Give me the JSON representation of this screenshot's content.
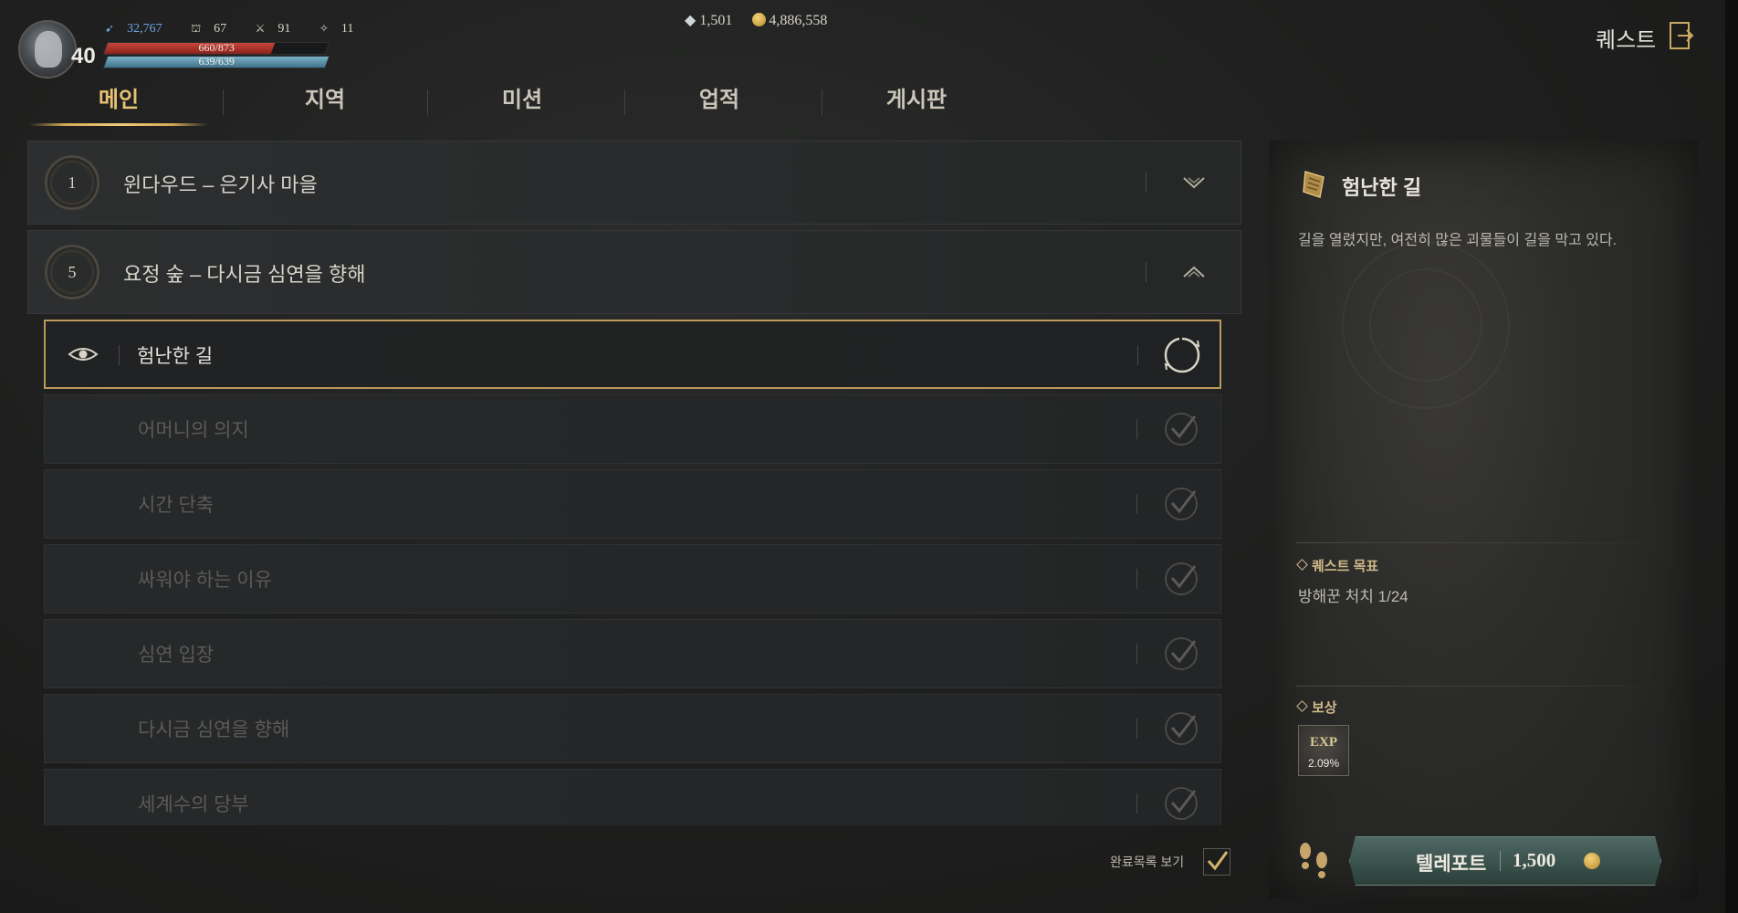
{
  "player": {
    "level": "40",
    "stats": {
      "power": "32,767",
      "defense": "67",
      "attack": "91",
      "crit": "11"
    },
    "hp": {
      "text": "660/873",
      "fill": 0.756
    },
    "mp": {
      "text": "639/639",
      "fill": 1.0
    }
  },
  "currency": {
    "gems": "1,501",
    "gold": "4,886,558"
  },
  "header": {
    "title": "퀘스트"
  },
  "tabs": [
    {
      "label": "메인",
      "active": true
    },
    {
      "label": "지역",
      "active": false
    },
    {
      "label": "미션",
      "active": false
    },
    {
      "label": "업적",
      "active": false
    },
    {
      "label": "게시판",
      "active": false
    }
  ],
  "chapters": [
    {
      "number": "1",
      "title": "윈다우드 – 은기사 마을",
      "expanded": false
    },
    {
      "number": "5",
      "title": "요정 숲 – 다시금 심연을 향해",
      "expanded": true
    }
  ],
  "quests": [
    {
      "title": "험난한 길",
      "status": "in-progress",
      "tracked": true
    },
    {
      "title": "어머니의 의지",
      "status": "complete"
    },
    {
      "title": "시간 단축",
      "status": "complete"
    },
    {
      "title": "싸워야 하는 이유",
      "status": "complete"
    },
    {
      "title": "심연 입장",
      "status": "complete"
    },
    {
      "title": "다시금 심연을 향해",
      "status": "complete"
    },
    {
      "title": "세계수의 당부",
      "status": "complete"
    }
  ],
  "show_completed": {
    "label": "완료목록 보기",
    "checked": true
  },
  "detail": {
    "title": "험난한 길",
    "description": "길을 열렸지만, 여전히 많은 괴물들이 길을 막고 있다.",
    "objective_label": "퀘스트 목표",
    "objective": "방해꾼 처치 1/24",
    "reward_label": "보상",
    "reward": {
      "type": "EXP",
      "value": "2.09%"
    }
  },
  "teleport": {
    "label": "텔레포트",
    "cost": "1,500"
  },
  "colors": {
    "accent_gold": "#e8c274",
    "teleport_teal": "#3a514c",
    "power_blue": "#6fa6e6",
    "hp_red": "#c8453a",
    "mp_teal": "#7bb2c8"
  }
}
